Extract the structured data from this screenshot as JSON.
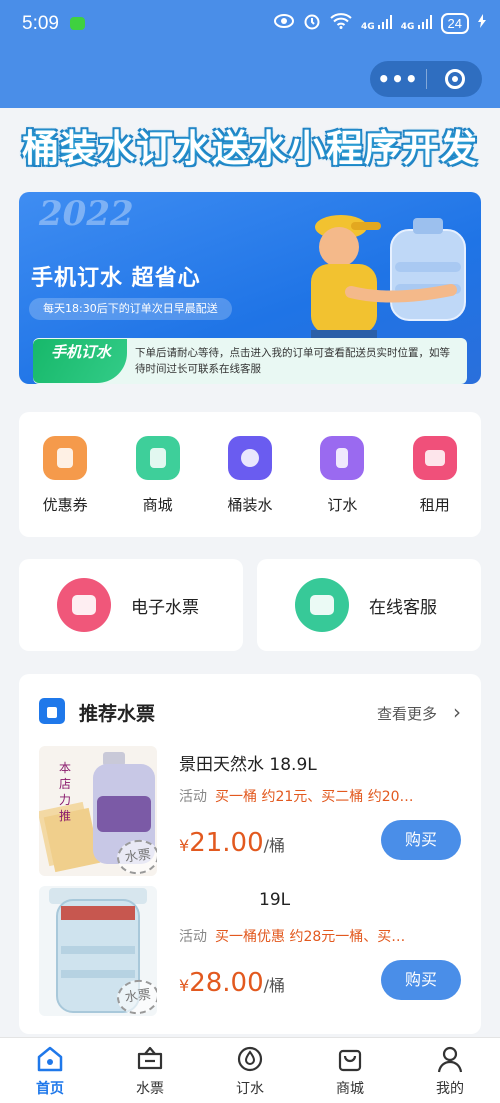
{
  "status_bar": {
    "time": "5:09",
    "battery": "24",
    "network_1": "4G",
    "network_2": "4G"
  },
  "header": {
    "more_icon": "more-dots-icon",
    "close_icon": "target-icon"
  },
  "page_title": "桶装水订水送水小程序开发",
  "hero": {
    "year_text": "2022",
    "headline": "手机订水 超省心",
    "pill_text": "每天18:30后下的订单次日早晨配送",
    "notice_tag": "手机订水",
    "notice_text": "下单后请耐心等待，点击进入我的订单可查看配送员实时位置，如等待时间过长可联系在线客服"
  },
  "categories": [
    {
      "label": "优惠券",
      "icon": "coupon-icon",
      "color": "#f59a4b"
    },
    {
      "label": "商城",
      "icon": "shop-icon",
      "color": "#3ecf9a"
    },
    {
      "label": "桶装水",
      "icon": "barrel-water-icon",
      "color": "#6a5cf0"
    },
    {
      "label": "订水",
      "icon": "order-water-icon",
      "color": "#9a6af0"
    },
    {
      "label": "租用",
      "icon": "layers-icon",
      "color": "#f0507a"
    }
  ],
  "services": [
    {
      "label": "电子水票",
      "icon": "ticket-icon",
      "color": "#f0577a"
    },
    {
      "label": "在线客服",
      "icon": "chat-icon",
      "color": "#37c998"
    }
  ],
  "recommend": {
    "title": "推荐水票",
    "more": "查看更多",
    "products": [
      {
        "name": "景田天然水 18.9L",
        "promo_tag": "活动",
        "promo_text": "买一桶 约21元、买二桶 约20…",
        "currency": "¥",
        "price": "21.00",
        "unit": "/桶",
        "buy": "购买",
        "stamp": "水票",
        "img_text": "本店力推"
      },
      {
        "name": "19L",
        "promo_tag": "活动",
        "promo_text": "买一桶优惠 约28元一桶、买…",
        "currency": "¥",
        "price": "28.00",
        "unit": "/桶",
        "buy": "购买",
        "stamp": "水票"
      }
    ]
  },
  "tabbar": [
    {
      "label": "首页",
      "icon": "home-icon",
      "active": true
    },
    {
      "label": "水票",
      "icon": "ticket-tab-icon",
      "active": false
    },
    {
      "label": "订水",
      "icon": "water-drop-icon",
      "active": false
    },
    {
      "label": "商城",
      "icon": "bag-icon",
      "active": false
    },
    {
      "label": "我的",
      "icon": "person-icon",
      "active": false
    }
  ],
  "colors": {
    "primary": "#4a8ee8",
    "accent": "#1f78ea",
    "price": "#e2591f"
  }
}
